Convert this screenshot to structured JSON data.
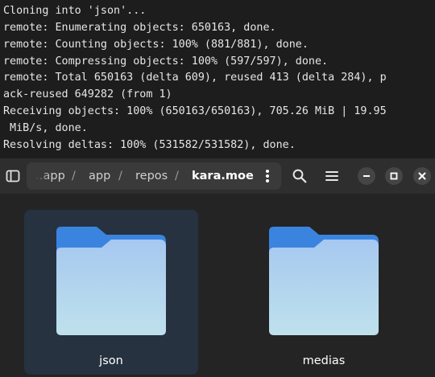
{
  "terminal": {
    "lines": [
      "Cloning into 'json'...",
      "remote: Enumerating objects: 650163, done.",
      "remote: Counting objects: 100% (881/881), done.",
      "remote: Compressing objects: 100% (597/597), done.",
      "remote: Total 650163 (delta 609), reused 413 (delta 284), p",
      "ack-reused 649282 (from 1)",
      "Receiving objects: 100% (650163/650163), 705.26 MiB | 19.95",
      " MiB/s, done.",
      "Resolving deltas: 100% (531582/531582), done."
    ]
  },
  "headerbar": {
    "breadcrumbs": [
      "…app",
      "app",
      "repos",
      "kara.moe"
    ],
    "separator": "/",
    "icons": {
      "sidebar": "sidebar-toggle-icon",
      "more": "vertical-dots-icon",
      "search": "search-icon",
      "menu": "hamburger-menu-icon",
      "minimize": "minimize-icon",
      "maximize": "maximize-icon",
      "close": "close-icon"
    }
  },
  "files": [
    {
      "name": "json",
      "selected": true
    },
    {
      "name": "medias",
      "selected": false
    }
  ],
  "colors": {
    "folder_tab": "#3a84df",
    "folder_front_top": "#a6c8f0",
    "folder_front_bottom": "#bfe1ec",
    "selection": "#263240"
  }
}
